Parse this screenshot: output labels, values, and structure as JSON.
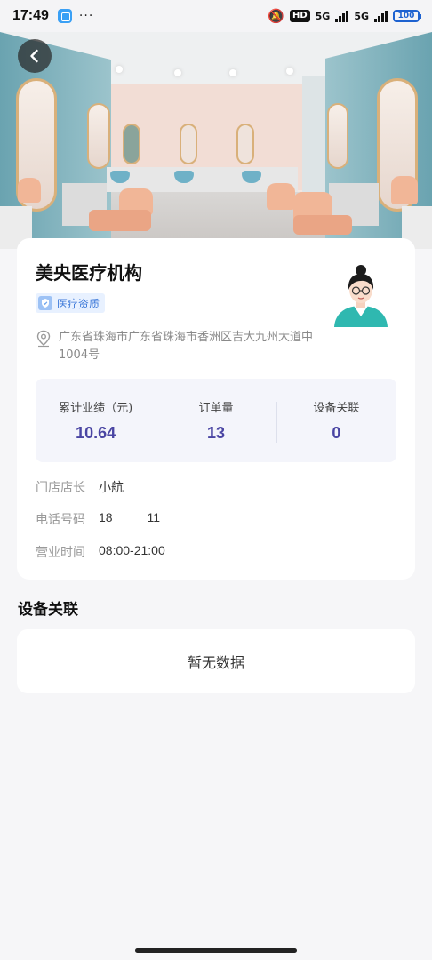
{
  "status_bar": {
    "time": "17:49",
    "dots": "···",
    "hd_label": "HD",
    "network_1": "5G",
    "network_2": "5G",
    "battery": "100"
  },
  "store": {
    "name": "美央医疗机构",
    "badge_label": "医疗资质",
    "address": "广东省珠海市广东省珠海市香洲区吉大九州大道中1004号"
  },
  "stats": [
    {
      "label": "累计业绩（元)",
      "value": "10.64"
    },
    {
      "label": "订单量",
      "value": "13"
    },
    {
      "label": "设备关联",
      "value": "0"
    }
  ],
  "info": {
    "manager_label": "门店店长",
    "manager_value": "小航",
    "phone_label": "电话号码",
    "phone_value": "18          11",
    "hours_label": "营业时间",
    "hours_value": "08:00-21:00"
  },
  "devices": {
    "section_title": "设备关联",
    "empty_text": "暂无数据"
  },
  "colors": {
    "accent": "#4a45a3",
    "badge_bg": "#e8f1ff",
    "badge_text": "#3b78d8",
    "page_bg": "#f6f6f8"
  },
  "icons": [
    "back-arrow-icon",
    "shield-icon",
    "location-pin-icon",
    "avatar-illustration"
  ]
}
